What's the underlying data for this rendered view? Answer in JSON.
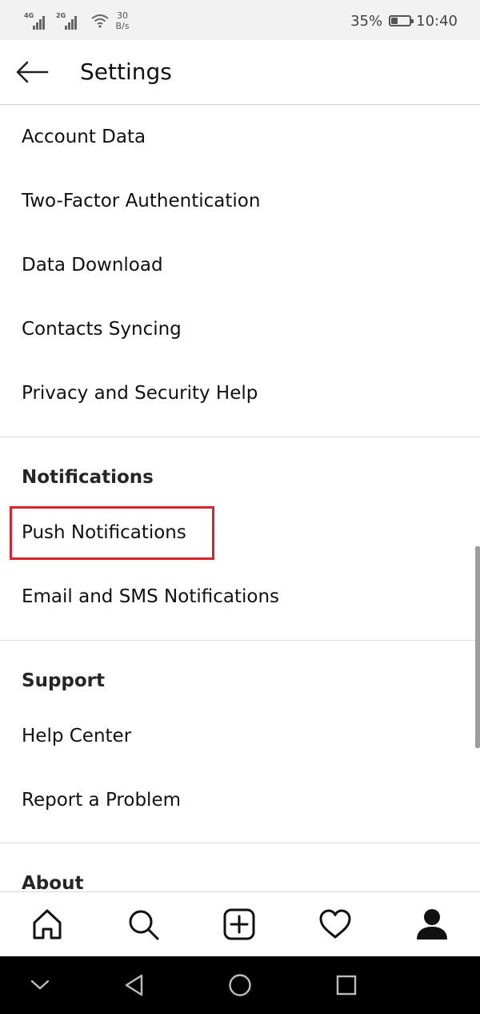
{
  "status_bar": {
    "signal_1_tag": "4G",
    "signal_2_tag": "2G",
    "network_speed_value": "30",
    "network_speed_unit": "B/s",
    "battery_percent": "35%",
    "battery_level": 0.35,
    "time": "10:40"
  },
  "header": {
    "back_icon": "arrow-left-icon",
    "title": "Settings"
  },
  "privacy_items": [
    {
      "label": "Account Data"
    },
    {
      "label": "Two-Factor Authentication"
    },
    {
      "label": "Data Download"
    },
    {
      "label": "Contacts Syncing"
    },
    {
      "label": "Privacy and Security Help"
    }
  ],
  "notifications": {
    "heading": "Notifications",
    "items": [
      {
        "label": "Push Notifications",
        "highlighted": true
      },
      {
        "label": "Email and SMS Notifications"
      }
    ]
  },
  "support": {
    "heading": "Support",
    "items": [
      {
        "label": "Help Center"
      },
      {
        "label": "Report a Problem"
      }
    ]
  },
  "about": {
    "heading": "About"
  },
  "tab_bar": {
    "tabs": [
      {
        "icon": "home-icon"
      },
      {
        "icon": "search-icon"
      },
      {
        "icon": "new-post-icon"
      },
      {
        "icon": "heart-icon"
      },
      {
        "icon": "profile-icon",
        "active": true
      }
    ]
  },
  "system_nav": {
    "buttons": [
      "chevron-down-icon",
      "back-triangle-icon",
      "home-circle-icon",
      "recents-square-icon"
    ]
  },
  "colors": {
    "highlight_border": "#d9232e",
    "status_bar_bg": "#f2f2f2",
    "divider": "#dbdbdb",
    "nav_bar_bg": "#000000"
  }
}
